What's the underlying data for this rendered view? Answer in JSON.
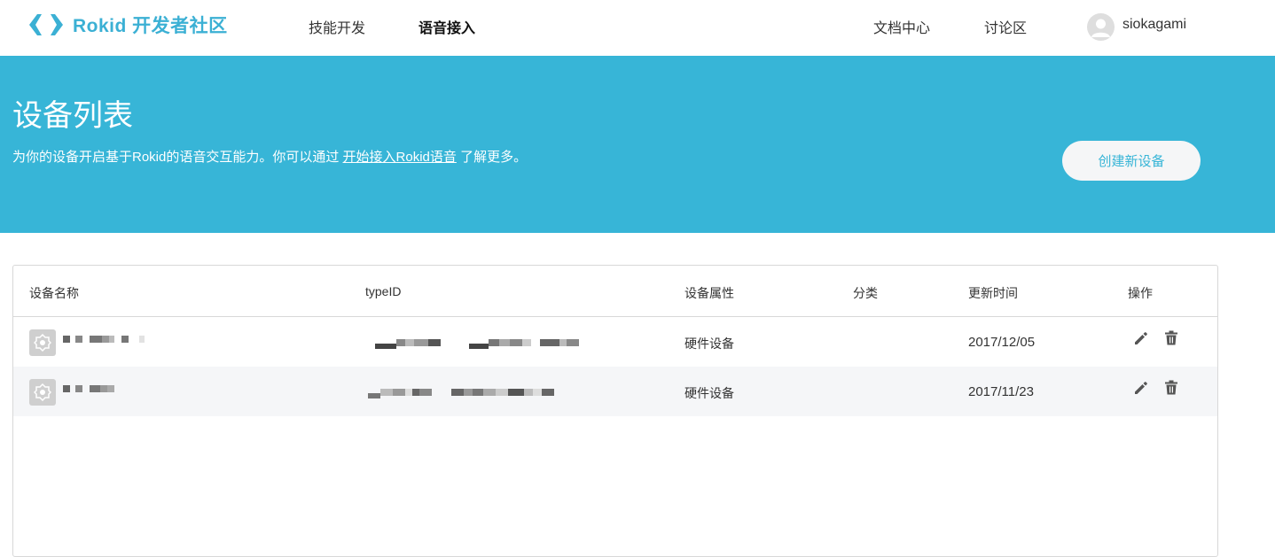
{
  "header": {
    "logo_text": "Rokid 开发者社区",
    "nav_left": [
      {
        "label": "技能开发",
        "active": false
      },
      {
        "label": "语音接入",
        "active": true
      }
    ],
    "nav_right": [
      {
        "label": "文档中心"
      },
      {
        "label": "讨论区"
      }
    ],
    "username": "siokagami"
  },
  "banner": {
    "title": "设备列表",
    "desc_prefix": "为你的设备开启基于Rokid的语音交互能力。你可以通过",
    "desc_link": "开始接入Rokid语音",
    "desc_suffix": "了解更多。",
    "create_button": "创建新设备"
  },
  "table": {
    "columns": [
      "设备名称",
      "typeID",
      "设备属性",
      "分类",
      "更新时间",
      "操作"
    ],
    "rows": [
      {
        "name": "",
        "type_id": "",
        "attribute": "硬件设备",
        "category": "",
        "updated": "2017/12/05"
      },
      {
        "name": "",
        "type_id": "",
        "attribute": "硬件设备",
        "category": "",
        "updated": "2017/11/23"
      }
    ]
  },
  "colors": {
    "brand": "#3bb0d4",
    "banner_bg": "#37b5d7",
    "row_alt_bg": "#f5f6f8"
  },
  "icons": {
    "logo": "chevrons-logo-icon",
    "avatar": "user-avatar-icon",
    "device": "device-gear-icon",
    "edit": "pencil-icon",
    "delete": "trash-icon"
  }
}
